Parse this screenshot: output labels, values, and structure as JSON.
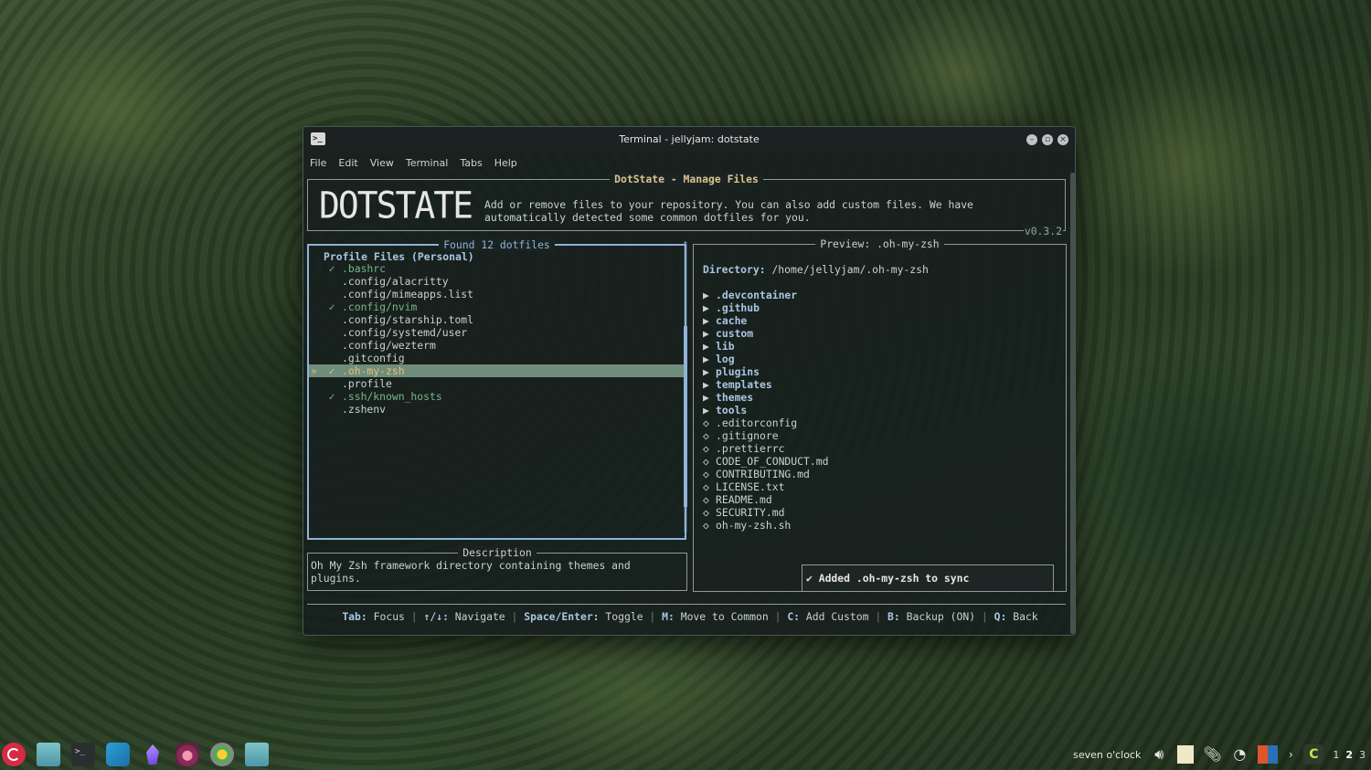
{
  "window": {
    "title": "Terminal - jellyjam: dotstate",
    "menu": [
      "File",
      "Edit",
      "View",
      "Terminal",
      "Tabs",
      "Help"
    ]
  },
  "app": {
    "header_title": "DotState - Manage Files",
    "logo_text": "DOTSTATE",
    "description_line1": "Add or remove files to your repository. You can also add custom files. We have",
    "description_line2": "automatically detected some common dotfiles for you.",
    "version": "v0.3.2"
  },
  "file_list": {
    "title": "Found 12 dotfiles",
    "section_heading": "Profile Files (Personal)",
    "cursor_marker": "»",
    "checkmark": "✓",
    "items": [
      {
        "name": ".bashrc",
        "checked": true,
        "selected": false
      },
      {
        "name": ".config/alacritty",
        "checked": false,
        "selected": false
      },
      {
        "name": ".config/mimeapps.list",
        "checked": false,
        "selected": false
      },
      {
        "name": ".config/nvim",
        "checked": true,
        "selected": false
      },
      {
        "name": ".config/starship.toml",
        "checked": false,
        "selected": false
      },
      {
        "name": ".config/systemd/user",
        "checked": false,
        "selected": false
      },
      {
        "name": ".config/wezterm",
        "checked": false,
        "selected": false
      },
      {
        "name": ".gitconfig",
        "checked": false,
        "selected": false
      },
      {
        "name": ".oh-my-zsh",
        "checked": true,
        "selected": true
      },
      {
        "name": ".profile",
        "checked": false,
        "selected": false
      },
      {
        "name": ".ssh/known_hosts",
        "checked": true,
        "selected": false
      },
      {
        "name": ".zshenv",
        "checked": false,
        "selected": false
      }
    ]
  },
  "description": {
    "title": "Description",
    "line1": "Oh My Zsh framework directory containing themes and",
    "line2": "plugins."
  },
  "preview": {
    "title": "Preview: .oh-my-zsh",
    "directory_label": "Directory:",
    "directory_path": "/home/jellyjam/.oh-my-zsh",
    "entries": [
      {
        "name": ".devcontainer",
        "kind": "dir"
      },
      {
        "name": ".github",
        "kind": "dir"
      },
      {
        "name": "cache",
        "kind": "dir"
      },
      {
        "name": "custom",
        "kind": "dir"
      },
      {
        "name": "lib",
        "kind": "dir"
      },
      {
        "name": "log",
        "kind": "dir"
      },
      {
        "name": "plugins",
        "kind": "dir"
      },
      {
        "name": "templates",
        "kind": "dir"
      },
      {
        "name": "themes",
        "kind": "dir"
      },
      {
        "name": "tools",
        "kind": "dir"
      },
      {
        "name": ".editorconfig",
        "kind": "file"
      },
      {
        "name": ".gitignore",
        "kind": "file"
      },
      {
        "name": ".prettierrc",
        "kind": "file"
      },
      {
        "name": "CODE_OF_CONDUCT.md",
        "kind": "file"
      },
      {
        "name": "CONTRIBUTING.md",
        "kind": "file"
      },
      {
        "name": "LICENSE.txt",
        "kind": "file"
      },
      {
        "name": "README.md",
        "kind": "file"
      },
      {
        "name": "SECURITY.md",
        "kind": "file"
      },
      {
        "name": "oh-my-zsh.sh",
        "kind": "file"
      }
    ],
    "dir_marker": "▶",
    "file_marker": "◇"
  },
  "toast": "✔ Added .oh-my-zsh to sync",
  "footer": {
    "shortcuts": [
      {
        "key": "Tab:",
        "action": "Focus"
      },
      {
        "key": "↑/↓:",
        "action": "Navigate"
      },
      {
        "key": "Space/Enter:",
        "action": "Toggle"
      },
      {
        "key": "M:",
        "action": "Move to Common"
      },
      {
        "key": "C:",
        "action": "Add Custom"
      },
      {
        "key": "B:",
        "action": "Backup (ON)"
      },
      {
        "key": "Q:",
        "action": "Back"
      }
    ],
    "separator": "|"
  },
  "taskbar": {
    "clock": "seven o'clock",
    "workspaces": [
      "1",
      "2",
      "3"
    ],
    "active_workspace": "2",
    "apps": [
      "debian-menu-icon",
      "files-icon",
      "terminal-icon",
      "text-editor-icon",
      "obsidian-icon",
      "browser-icon",
      "chrome-icon",
      "files-icon"
    ]
  },
  "colors": {
    "accent_blue": "#8fb3d8",
    "tracked_green": "#7ab38f",
    "selection_bg": "#6f8d7a",
    "title_gold": "#dac58f"
  }
}
